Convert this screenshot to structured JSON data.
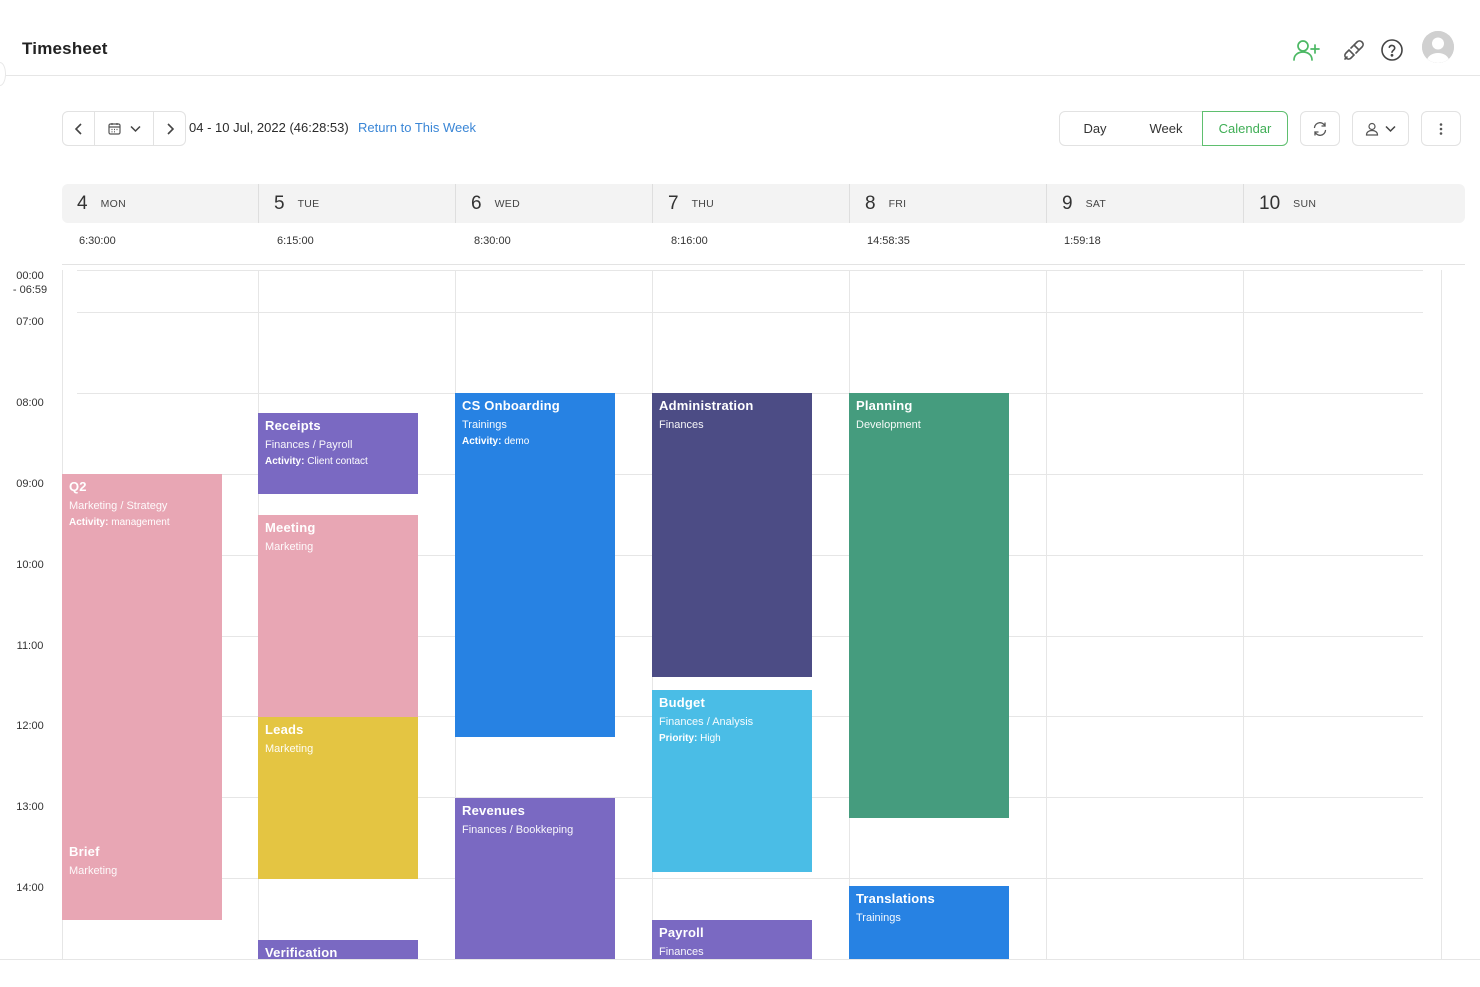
{
  "app": {
    "title": "Timesheet"
  },
  "toolbar": {
    "range_label": "04 - 10 Jul, 2022 (46:28:53)",
    "return_label": "Return to This Week",
    "views": [
      "Day",
      "Week",
      "Calendar"
    ],
    "active_view": "Calendar"
  },
  "days": [
    {
      "num": "4",
      "dow": "MON",
      "total": "6:30:00"
    },
    {
      "num": "5",
      "dow": "TUE",
      "total": "6:15:00"
    },
    {
      "num": "6",
      "dow": "WED",
      "total": "8:30:00"
    },
    {
      "num": "7",
      "dow": "THU",
      "total": "8:16:00"
    },
    {
      "num": "8",
      "dow": "FRI",
      "total": "14:58:35"
    },
    {
      "num": "9",
      "dow": "SAT",
      "total": "1:59:18"
    },
    {
      "num": "10",
      "dow": "SUN",
      "total": ""
    }
  ],
  "hours": [
    "00:00\n- 06:59",
    "07:00",
    "08:00",
    "09:00",
    "10:00",
    "11:00",
    "12:00",
    "13:00",
    "14:00"
  ],
  "events": [
    {
      "day": 0,
      "start": "09:00",
      "end": "13:30",
      "title": "Q2",
      "sub": "Marketing / Strategy",
      "extra_key": "Activity:",
      "extra_val": "management",
      "color": "#e8a6b4"
    },
    {
      "day": 0,
      "start": "13:30",
      "end": "14:30",
      "title": "Brief",
      "sub": "Marketing",
      "color": "#e8a6b4"
    },
    {
      "day": 1,
      "start": "08:15",
      "end": "09:15",
      "title": "Receipts",
      "sub": "Finances / Payroll",
      "extra_key": "Activity:",
      "extra_val": "Client contact",
      "color": "#7a69c2"
    },
    {
      "day": 1,
      "start": "09:30",
      "end": "12:00",
      "title": "Meeting",
      "sub": "Marketing",
      "color": "#e8a6b4"
    },
    {
      "day": 1,
      "start": "12:00",
      "end": "14:00",
      "title": "Leads",
      "sub": "Marketing",
      "color": "#e4c542"
    },
    {
      "day": 1,
      "start": "14:45",
      "end": "15:00",
      "title": "Verification",
      "sub": "",
      "color": "#7a69c2"
    },
    {
      "day": 2,
      "start": "08:00",
      "end": "12:15",
      "title": "CS Onboarding",
      "sub": "Trainings",
      "extra_key": "Activity:",
      "extra_val": "demo",
      "color": "#2782e3"
    },
    {
      "day": 2,
      "start": "13:00",
      "end": "15:00",
      "title": "Revenues",
      "sub": "Finances / Bookkeping",
      "color": "#7a69c2"
    },
    {
      "day": 3,
      "start": "08:00",
      "end": "11:30",
      "title": "Administration",
      "sub": "Finances",
      "color": "#4c4c85"
    },
    {
      "day": 3,
      "start": "11:40",
      "end": "13:55",
      "title": "Budget",
      "sub": "Finances / Analysis",
      "extra_key": "Priority:",
      "extra_val": "High",
      "color": "#4abde6"
    },
    {
      "day": 3,
      "start": "14:30",
      "end": "15:00",
      "title": "Payroll",
      "sub": "Finances",
      "color": "#7a69c2"
    },
    {
      "day": 4,
      "start": "08:00",
      "end": "13:15",
      "title": "Planning",
      "sub": "Development",
      "color": "#459c7e"
    },
    {
      "day": 4,
      "start": "14:05",
      "end": "15:00",
      "title": "Translations",
      "sub": "Trainings",
      "color": "#2782e3"
    }
  ]
}
